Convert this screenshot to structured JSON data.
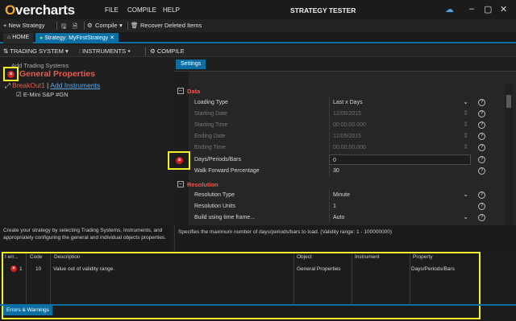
{
  "app": {
    "logo_text": "Overcharts",
    "title": "STRATEGY TESTER",
    "menu": [
      "FILE",
      "COMPILE",
      "HELP"
    ]
  },
  "toolbar1": {
    "new_strategy": "+ New Strategy",
    "compile": "Compile",
    "recover": "Recover Deleted Items"
  },
  "tabs": {
    "home": "HOME",
    "active": "Strategy: MyFirstStrategy"
  },
  "toolbar2": {
    "trading_system": "TRADING SYSTEM",
    "instruments": "INSTRUMENTS",
    "compile": "COMPILE"
  },
  "left_panel": {
    "add_trading_systems": "Add Trading Systems",
    "general_properties": "General Properties",
    "breakout": "BreakOut1",
    "add_instruments": "Add Instruments",
    "instrument": "E-Mini S&P #GN",
    "description": "Create your strategy by selecting Trading Systems, Instruments, and appropriately configuring the general and individual objects properties."
  },
  "settings": {
    "tab": "Settings",
    "sections": {
      "data": "Data",
      "resolution": "Resolution"
    },
    "rows": {
      "loading_type": {
        "name": "Loading Type",
        "value": "Last x Days"
      },
      "starting_date": {
        "name": "Starting Date",
        "value": "12/05/2015"
      },
      "starting_time": {
        "name": "Starting Time",
        "value": "00:00:00.000"
      },
      "ending_date": {
        "name": "Ending Date",
        "value": "12/05/2015"
      },
      "ending_time": {
        "name": "Ending Time",
        "value": "00:00:00.000"
      },
      "days_periods_bars": {
        "name": "Days/Periods/Bars",
        "value": "0"
      },
      "walk_forward": {
        "name": "Walk Forward Percentage",
        "value": "30"
      },
      "resolution_type": {
        "name": "Resolution Type",
        "value": "Minute"
      },
      "resolution_units": {
        "name": "Resolution Units",
        "value": "1"
      },
      "build_using": {
        "name": "Build using time frame...",
        "value": "Auto"
      }
    },
    "info": "Specifies the maximum number of days/periods/bars to load. (Validity range: 1 - 100000000)"
  },
  "errors": {
    "headers": [
      "I err...",
      "Code",
      "Description",
      "Object",
      "Instrument",
      "Property"
    ],
    "rows": [
      {
        "index": "1",
        "code": "10",
        "description": "Value out of validity range.",
        "object": "General Properties",
        "instrument": "",
        "property": "Days/Periods/Bars"
      }
    ],
    "tab": "Errors & Warnings"
  },
  "colors": {
    "accent": "#0b6fa4",
    "error": "#d11f1f",
    "highlight": "#f1f12b",
    "section": "#e85a4f"
  }
}
